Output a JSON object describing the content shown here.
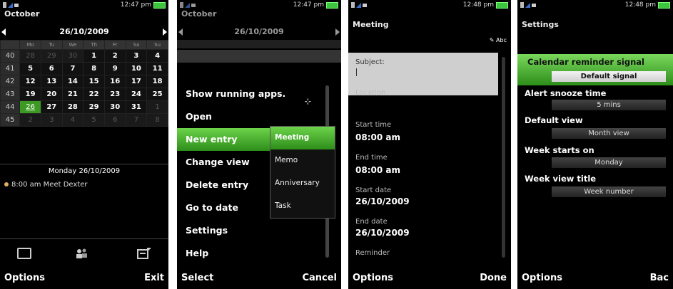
{
  "colors": {
    "accent": "#3c9a24",
    "background": "#000000",
    "subject_box": "#cfcfcf"
  },
  "s1": {
    "time": "12:47 pm",
    "title": "October",
    "date": "26/10/2009",
    "weekdays": [
      "Mo",
      "Tu",
      "We",
      "Th",
      "Fr",
      "Sa",
      "Su"
    ],
    "weeks": [
      [
        "40",
        "28",
        "29",
        "30",
        "1",
        "2",
        "3",
        "4"
      ],
      [
        "41",
        "5",
        "6",
        "7",
        "8",
        "9",
        "10",
        "11"
      ],
      [
        "42",
        "12",
        "13",
        "14",
        "15",
        "16",
        "17",
        "18"
      ],
      [
        "43",
        "19",
        "20",
        "21",
        "22",
        "23",
        "24",
        "25"
      ],
      [
        "44",
        "26",
        "27",
        "28",
        "29",
        "30",
        "31",
        "1"
      ],
      [
        "45",
        "2",
        "3",
        "4",
        "5",
        "6",
        "7",
        "8"
      ]
    ],
    "day_heading": "Monday 26/10/2009",
    "event": "8:00 am Meet Dexter",
    "tool_icons": [
      "calendar-view-icon",
      "people-icon",
      "new-entry-icon"
    ],
    "soft_left": "Options",
    "soft_right": "Exit"
  },
  "s2": {
    "time": "12:47 pm",
    "title": "October",
    "date": "26/10/2009",
    "menu": [
      "Show running apps.",
      "Open",
      "New entry",
      "Change view",
      "Delete entry",
      "Go to date",
      "Settings",
      "Help"
    ],
    "submenu": [
      "Meeting",
      "Memo",
      "Anniversary",
      "Task"
    ],
    "soft_left": "Select",
    "soft_right": "Cancel"
  },
  "s3": {
    "time": "12:48 pm",
    "title": "Meeting",
    "input_mode": "Abc",
    "subject_label": "Subject:",
    "location_label": "Location",
    "start_time_label": "Start time",
    "start_time": "08:00 am",
    "end_time_label": "End time",
    "end_time": "08:00 am",
    "start_date_label": "Start date",
    "start_date": "26/10/2009",
    "end_date_label": "End date",
    "end_date": "26/10/2009",
    "reminder_label": "Reminder",
    "soft_left": "Options",
    "soft_right": "Done"
  },
  "s4": {
    "time": "12:48 pm",
    "title": "Settings",
    "items": [
      {
        "label": "Calendar reminder signal",
        "value": "Default signal"
      },
      {
        "label": "Alert snooze time",
        "value": "5 mins"
      },
      {
        "label": "Default view",
        "value": "Month view"
      },
      {
        "label": "Week starts on",
        "value": "Monday"
      },
      {
        "label": "Week view title",
        "value": "Week number"
      }
    ],
    "soft_left": "Options",
    "soft_right": "Bac"
  }
}
